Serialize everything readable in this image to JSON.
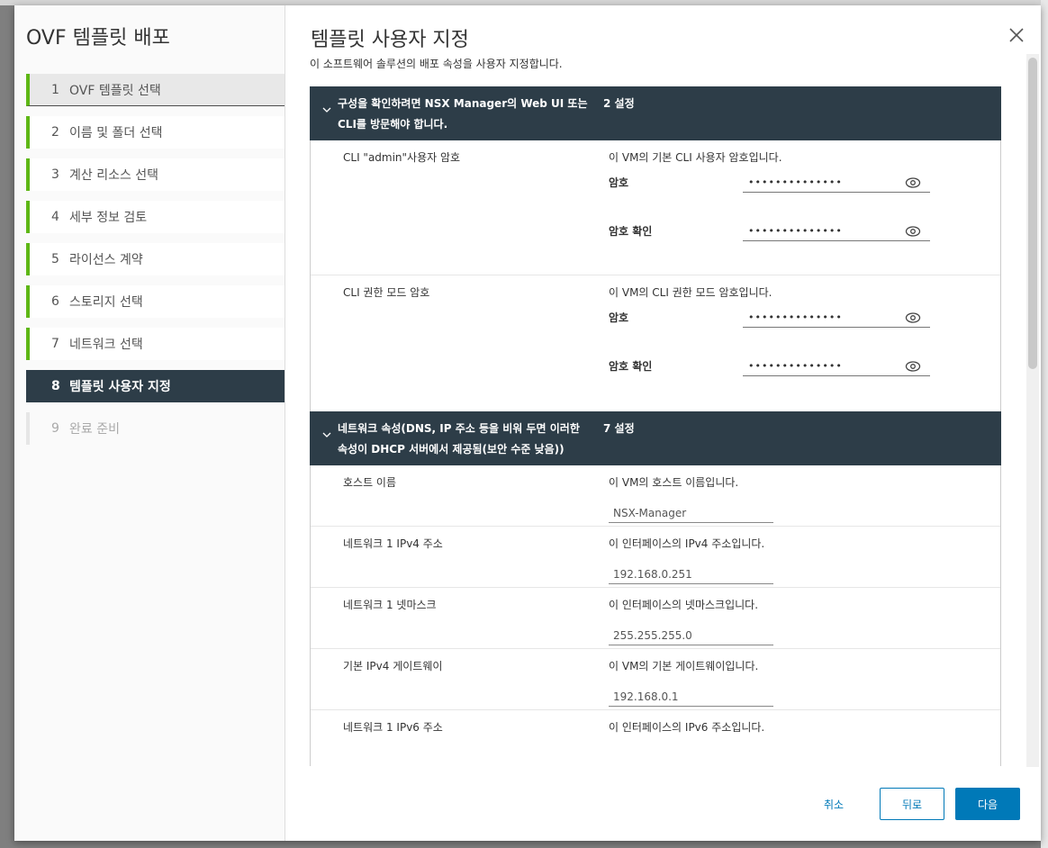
{
  "wizard": {
    "title": "OVF 템플릿 배포",
    "steps": [
      {
        "num": "1",
        "label": "OVF 템플릿 선택"
      },
      {
        "num": "2",
        "label": "이름 및 폴더 선택"
      },
      {
        "num": "3",
        "label": "계산 리소스 선택"
      },
      {
        "num": "4",
        "label": "세부 정보 검토"
      },
      {
        "num": "5",
        "label": "라이선스 계약"
      },
      {
        "num": "6",
        "label": "스토리지 선택"
      },
      {
        "num": "7",
        "label": "네트워크 선택"
      },
      {
        "num": "8",
        "label": "템플릿 사용자 지정"
      },
      {
        "num": "9",
        "label": "완료 준비"
      }
    ]
  },
  "page": {
    "title": "템플릿 사용자 지정",
    "description": "이 소프트웨어 솔루션의 배포 속성을 사용자 지정합니다."
  },
  "sections": [
    {
      "title_line1": "구성을 확인하려면 NSX Manager의 Web UI 또는",
      "title_line2": "CLI를 방문해야 합니다.",
      "count": "2 설정",
      "props": [
        {
          "label": "CLI \"admin\"사용자 암호",
          "desc": "이 VM의 기본 CLI 사용자 암호입니다.",
          "password_label": "암호",
          "password_value": "••••••••••••••",
          "confirm_label": "암호 확인",
          "confirm_value": "••••••••••••••"
        },
        {
          "label": "CLI 권한 모드 암호",
          "desc": "이 VM의 CLI 권한 모드 암호입니다.",
          "password_label": "암호",
          "password_value": "••••••••••••••",
          "confirm_label": "암호 확인",
          "confirm_value": "••••••••••••••"
        }
      ]
    },
    {
      "title_line1": "네트워크 속성(DNS, IP 주소 등을 비워 두면 이러한",
      "title_line2": "속성이 DHCP 서버에서 제공됨(보안 수준 낮음))",
      "count": "7 설정",
      "props": [
        {
          "label": "호스트 이름",
          "desc": "이 VM의 호스트 이름입니다.",
          "value": "NSX-Manager"
        },
        {
          "label": "네트워크 1 IPv4 주소",
          "desc": "이 인터페이스의 IPv4 주소입니다.",
          "value": "192.168.0.251"
        },
        {
          "label": "네트워크 1 넷마스크",
          "desc": "이 인터페이스의 넷마스크입니다.",
          "value": "255.255.255.0"
        },
        {
          "label": "기본 IPv4 게이트웨이",
          "desc": "이 VM의 기본 게이트웨이입니다.",
          "value": "192.168.0.1"
        },
        {
          "label": "네트워크 1 IPv6 주소",
          "desc": "이 인터페이스의 IPv6 주소입니다.",
          "value": ""
        }
      ]
    }
  ],
  "footer": {
    "cancel": "취소",
    "back": "뒤로",
    "next": "다음"
  },
  "colors": {
    "header_bg": "#2d3d48",
    "accent_green": "#5eb715",
    "primary_blue": "#0079b8"
  },
  "icons": [
    "close-icon",
    "chevron-down-icon",
    "eye-icon"
  ]
}
